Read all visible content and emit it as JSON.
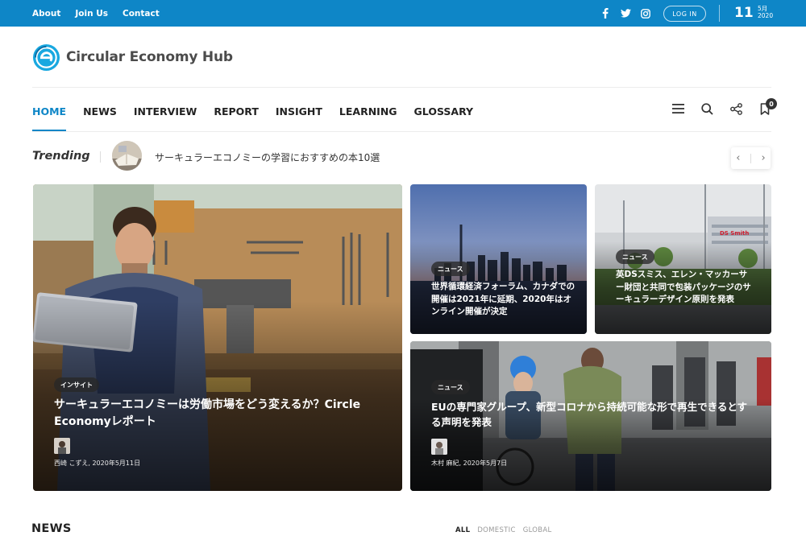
{
  "topbar": {
    "links": [
      "About",
      "Join Us",
      "Contact"
    ],
    "social_icons": [
      "facebook-icon",
      "twitter-icon",
      "instagram-icon"
    ],
    "login_label": "LOG IN",
    "date_day": "11",
    "date_month": "5月",
    "date_year": "2020",
    "bg_color": "#0e86c7"
  },
  "logo": {
    "text": "Circular Economy Hub"
  },
  "nav": {
    "items": [
      {
        "label": "HOME",
        "active": true
      },
      {
        "label": "NEWS"
      },
      {
        "label": "INTERVIEW"
      },
      {
        "label": "REPORT"
      },
      {
        "label": "INSIGHT"
      },
      {
        "label": "LEARNING"
      },
      {
        "label": "GLOSSARY"
      }
    ],
    "icons": [
      "menu-icon",
      "search-icon",
      "share-icon",
      "bookmark-icon"
    ],
    "bookmark_count": "0",
    "accent": "#0e86c7"
  },
  "trending": {
    "label": "Trending",
    "headline": "サーキュラーエコノミーの学習におすすめの本10選",
    "prev": "‹",
    "next": "›"
  },
  "featured": {
    "main": {
      "tag": "インサイト",
      "title": "サーキュラーエコノミーは労働市場をどう変えるか？Circle Economyレポート",
      "meta": "西崎 こずえ, 2020年5月11日"
    },
    "top_middle": {
      "tag": "ニュース",
      "title": "世界循環経済フォーラム、カナダでの開催は2021年に延期、2020年はオンライン開催が決定"
    },
    "top_right": {
      "tag": "ニュース",
      "title": "英DSスミス、エレン・マッカーサー財団と共同で包装パッケージのサーキュラーデザイン原則を発表",
      "sign": "DS Smith"
    },
    "bottom_wide": {
      "tag": "ニュース",
      "title": "EUの専門家グループ、新型コロナから持続可能な形で再生できるとする声明を発表",
      "meta": "木村 麻紀, 2020年5月7日"
    }
  },
  "news": {
    "heading": "NEWS",
    "filters": [
      "ALL",
      "DOMESTIC",
      "GLOBAL"
    ]
  }
}
